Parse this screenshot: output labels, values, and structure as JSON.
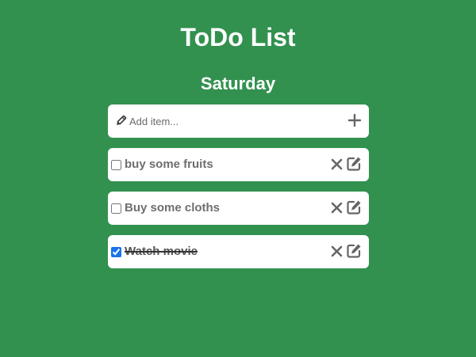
{
  "header": {
    "title": "ToDo List",
    "day": "Saturday"
  },
  "add_item": {
    "placeholder": "Add item...",
    "value": "",
    "leading_icon": "pencil-icon",
    "action_icon": "plus-icon"
  },
  "todos": [
    {
      "label": "buy some fruits",
      "checked": false
    },
    {
      "label": "Buy some cloths",
      "checked": false
    },
    {
      "label": "Watch movie",
      "checked": true
    }
  ],
  "item_actions": {
    "delete_icon": "x-icon",
    "edit_icon": "edit-icon"
  },
  "colors": {
    "background": "#32914f",
    "card": "#ffffff",
    "icon": "#666666",
    "item_text": "#6e6e6e"
  }
}
